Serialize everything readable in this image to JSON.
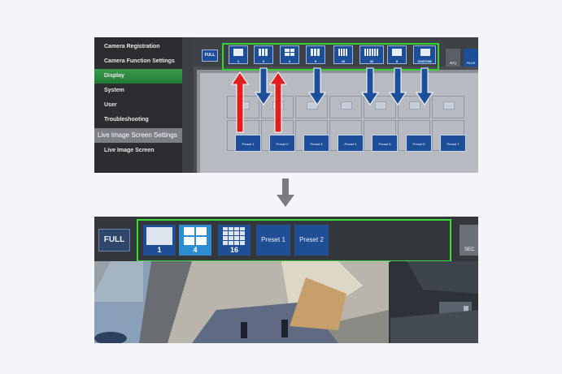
{
  "sidebar": {
    "items": [
      {
        "label": "Camera Registration"
      },
      {
        "label": "Camera Function Settings"
      },
      {
        "label": "Display"
      },
      {
        "label": "System"
      },
      {
        "label": "User"
      },
      {
        "label": "Troubleshooting"
      },
      {
        "label": "Live Image Screen Settings"
      },
      {
        "label": "Live Image Screen"
      }
    ]
  },
  "top_toolbar": {
    "full_label": "FULL",
    "layouts": [
      "1",
      "3",
      "4",
      "9",
      "16",
      "32",
      "8",
      "CUSTOM"
    ],
    "right_labels": [
      "SEQ",
      "PAGE"
    ]
  },
  "top_settings": {
    "presets": [
      "Preset 1",
      "Preset 2",
      "Preset 3",
      "Preset 4",
      "Preset 5",
      "Preset 6",
      "Preset 7"
    ],
    "faded_labels": [
      "1",
      "3",
      "4",
      "9",
      "16",
      "32",
      "8",
      "CUSTOM"
    ]
  },
  "bottom_toolbar": {
    "full_label": "FULL",
    "layouts": [
      "1",
      "4",
      "16"
    ],
    "presets": [
      "Preset 1",
      "Preset 2"
    ],
    "seq_label": "SEC"
  },
  "colors": {
    "highlight": "#35d435",
    "arrow_up": "#e21f1f",
    "arrow_down": "#1d4e9a",
    "selected": "#2c8ed1"
  }
}
